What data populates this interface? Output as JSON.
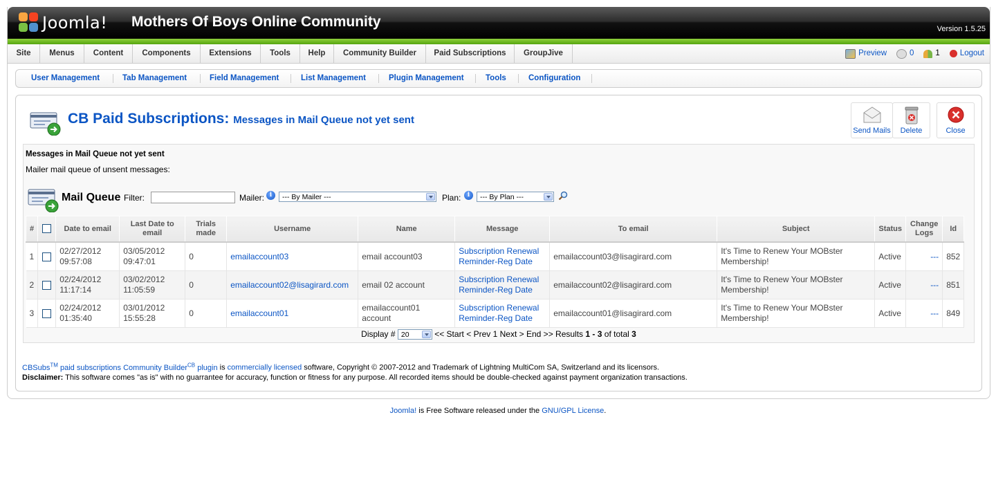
{
  "header": {
    "brand": "Joomla!",
    "site_title": "Mothers Of Boys Online Community",
    "version": "Version 1.5.25"
  },
  "menu": [
    "Site",
    "Menus",
    "Content",
    "Components",
    "Extensions",
    "Tools",
    "Help",
    "Community Builder",
    "Paid Subscriptions",
    "GroupJive"
  ],
  "status": {
    "preview": "Preview",
    "messages_count": "0",
    "users_count": "1",
    "logout": "Logout"
  },
  "submenu": [
    "User Management",
    "Tab Management",
    "Field Management",
    "List Management",
    "Plugin Management",
    "Tools",
    "Configuration"
  ],
  "page": {
    "title": "CB Paid Subscriptions:",
    "subtitle": "Messages in Mail Queue not yet sent"
  },
  "toolbar": {
    "send_mails": "Send Mails",
    "delete": "Delete",
    "close": "Close"
  },
  "inner": {
    "title": "Messages in Mail Queue not yet sent",
    "description": "Mailer mail queue of unsent messages:"
  },
  "filters": {
    "section_title": "Mail Queue",
    "filter_label": "Filter:",
    "filter_value": "",
    "mailer_label": "Mailer:",
    "mailer_selected": "--- By Mailer ---",
    "plan_label": "Plan:",
    "plan_selected": "--- By Plan ---"
  },
  "table": {
    "columns": [
      "#",
      "",
      "Date to email",
      "Last Date to email",
      "Trials made",
      "Username",
      "Name",
      "Message",
      "To email",
      "Subject",
      "Status",
      "Change Logs",
      "Id"
    ],
    "rows": [
      {
        "num": "1",
        "date_to_email": "02/27/2012 09:57:08",
        "last_date": "03/05/2012 09:47:01",
        "trials": "0",
        "username": "emailaccount03",
        "name": "email account03",
        "message": "Subscription Renewal Reminder-Reg Date",
        "to_email": "emailaccount03@lisagirard.com",
        "subject": "It's Time to Renew Your MOBster Membership!",
        "status": "Active",
        "change_logs": "---",
        "id": "852"
      },
      {
        "num": "2",
        "date_to_email": "02/24/2012 11:17:14",
        "last_date": "03/02/2012 11:05:59",
        "trials": "0",
        "username": "emailaccount02@lisagirard.com",
        "name": "email 02 account",
        "message": "Subscription Renewal Reminder-Reg Date",
        "to_email": "emailaccount02@lisagirard.com",
        "subject": "It's Time to Renew Your MOBster Membership!",
        "status": "Active",
        "change_logs": "---",
        "id": "851"
      },
      {
        "num": "3",
        "date_to_email": "02/24/2012 01:35:40",
        "last_date": "03/01/2012 15:55:28",
        "trials": "0",
        "username": "emailaccount01",
        "name": "emailaccount01 account",
        "message": "Subscription Renewal Reminder-Reg Date",
        "to_email": "emailaccount01@lisagirard.com",
        "subject": "It's Time to Renew Your MOBster Membership!",
        "status": "Active",
        "change_logs": "---",
        "id": "849"
      }
    ]
  },
  "pager": {
    "display_label": "Display #",
    "display_value": "20",
    "start": "<< Start",
    "prev": "< Prev",
    "page": "1",
    "next": "Next >",
    "end": "End >>",
    "results_prefix": "Results",
    "results_range": "1 - 3",
    "results_mid": "of total",
    "results_total": "3"
  },
  "credits": {
    "cbsubs": "CBSubs",
    "tm": "TM",
    "paid_subs": "paid subscriptions Community Builder",
    "cb": "CB",
    "plugin": "plugin",
    "is": "is",
    "commercially_licensed": "commercially licensed",
    "copyright": "software, Copyright © 2007-2012 and Trademark of Lightning MultiCom SA, Switzerland and its licensors.",
    "disclaimer_label": "Disclaimer:",
    "disclaimer": "This software comes \"as is\" with no guarrantee for accuracy, function or fitness for any purpose. All recorded items should be double-checked against payment organization transactions."
  },
  "footer": {
    "joomla": "Joomla!",
    "text": "is Free Software released under the",
    "license": "GNU/GPL License",
    "period": "."
  },
  "colors": {
    "link": "#0b55c4",
    "header_bg": "#000000",
    "green_bar": "#6abf1e"
  }
}
